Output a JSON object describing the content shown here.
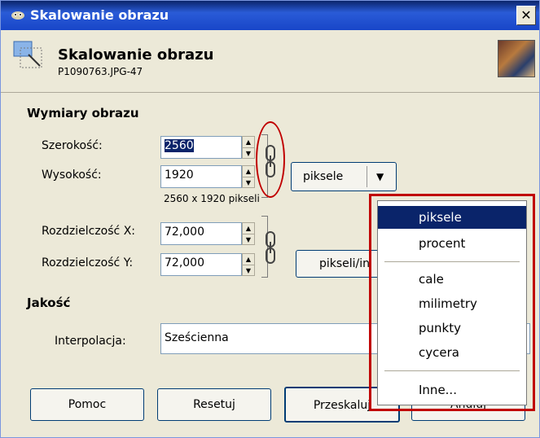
{
  "window": {
    "title": "Skalowanie obrazu",
    "close": "✕"
  },
  "header": {
    "title": "Skalowanie obrazu",
    "subtitle": "P1090763.JPG-47"
  },
  "image_size": {
    "section": "Wymiary obrazu",
    "width_label": "Szerokość:",
    "width_value": "2560",
    "height_label": "Wysokość:",
    "height_value": "1920",
    "size_info": "2560 x 1920 pikseli",
    "unit": "piksele",
    "dropdown_arrow": "▼"
  },
  "resolution": {
    "x_label": "Rozdzielczość X:",
    "x_value": "72,000",
    "y_label": "Rozdzielczość Y:",
    "y_value": "72,000",
    "unit": "pikseli/in"
  },
  "quality": {
    "section": "Jakość",
    "interp_label": "Interpolacja:",
    "interp_value": "Sześcienna"
  },
  "buttons": {
    "help": "Pomoc",
    "reset": "Resetuj",
    "scale": "Przeskaluj",
    "cancel": "Anuluj"
  },
  "unit_menu": {
    "items": [
      "piksele",
      "procent",
      "cale",
      "milimetry",
      "punkty",
      "cycera",
      "Inne..."
    ],
    "selected": "piksele"
  }
}
